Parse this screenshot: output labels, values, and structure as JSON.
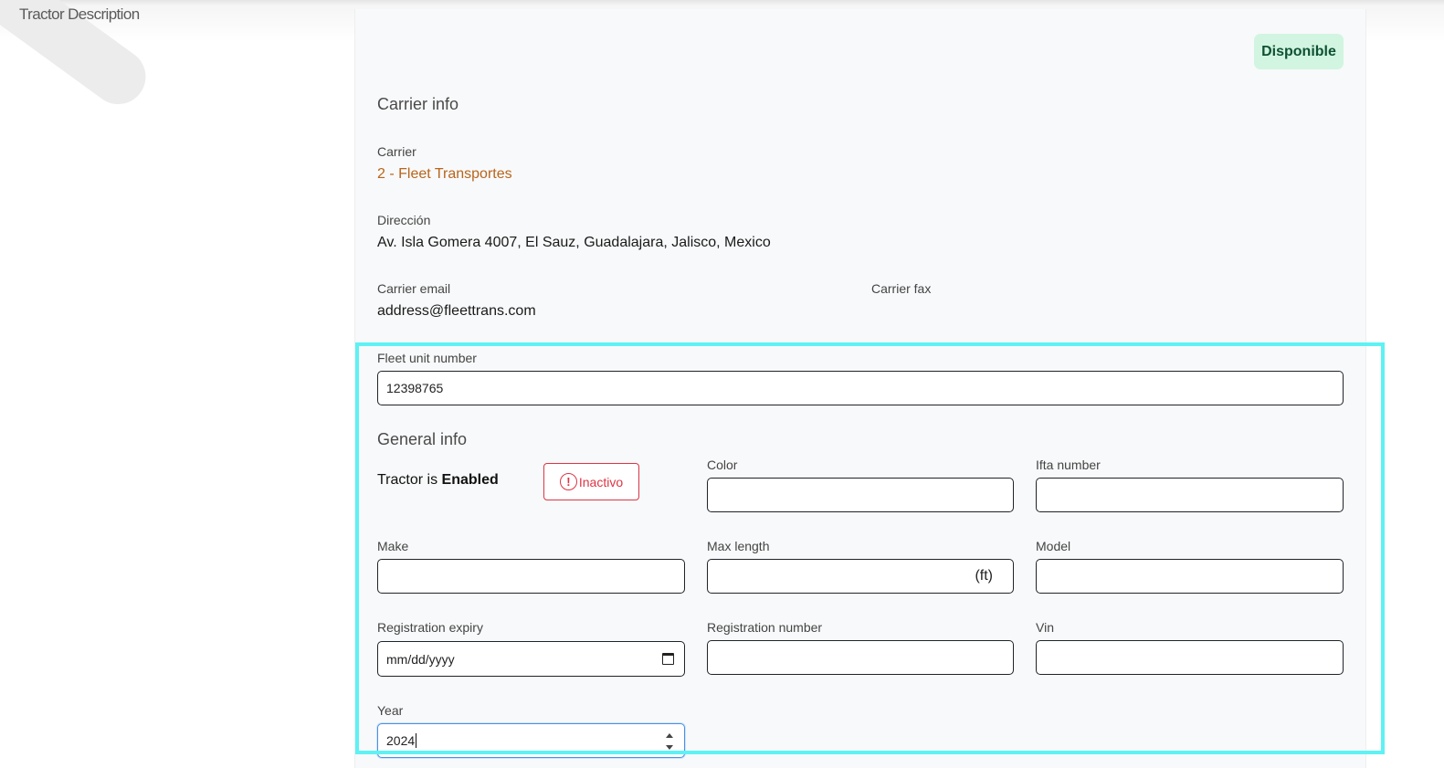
{
  "header": {
    "title": "Tractor Description"
  },
  "status_badge": "Disponible",
  "carrier_info": {
    "section_title": "Carrier info",
    "carrier_label": "Carrier",
    "carrier_value": "2 - Fleet Transportes",
    "address_label": "Dirección",
    "address_value": "Av. Isla Gomera 4007, El Sauz, Guadalajara, Jalisco, Mexico",
    "email_label": "Carrier email",
    "email_value": "address@fleettrans.com",
    "fax_label": "Carrier fax"
  },
  "fleet_unit": {
    "label": "Fleet unit number",
    "value": "12398765"
  },
  "general_info": {
    "section_title": "General info",
    "status_prefix": "Tractor is ",
    "status_value": "Enabled",
    "toggle_button": "Inactivo",
    "fields": {
      "color": {
        "label": "Color",
        "value": ""
      },
      "ifta": {
        "label": "Ifta number",
        "value": ""
      },
      "make": {
        "label": "Make",
        "value": ""
      },
      "max_length": {
        "label": "Max length",
        "value": "",
        "unit": "(ft)"
      },
      "model": {
        "label": "Model",
        "value": ""
      },
      "registration_expiry": {
        "label": "Registration expiry",
        "value": "mm/dd/yyyy"
      },
      "registration_number": {
        "label": "Registration number",
        "value": ""
      },
      "vin": {
        "label": "Vin",
        "value": ""
      },
      "year": {
        "label": "Year",
        "value": "2024"
      }
    }
  },
  "colors": {
    "badge_bg": "#d1f5e0",
    "badge_text": "#0f5132",
    "link": "#b8651b",
    "danger": "#dc3545",
    "highlight": "#5ef2f4",
    "focus": "#4a90e2"
  },
  "icons": {
    "warning": "exclamation-circle-icon",
    "calendar": "calendar-icon",
    "spinner": "spinner-arrows-icon"
  }
}
